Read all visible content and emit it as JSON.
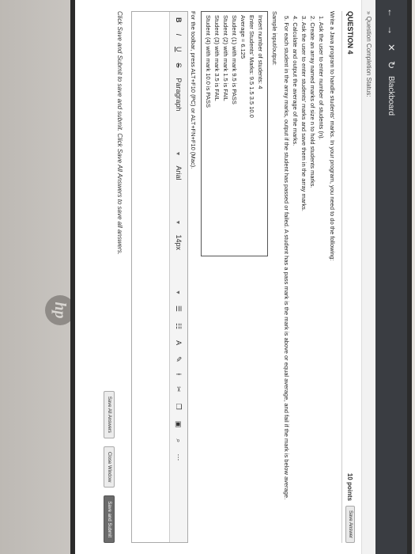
{
  "browser": {
    "tab_title": "Blackboard",
    "back_icon": "left-arrow-icon",
    "forward_icon": "right-arrow-icon"
  },
  "breadcrumb": "» Question Completion Status:",
  "question": {
    "title": "QUESTION 4",
    "points": "10 points",
    "save_answer": "Save Answer",
    "intro": "Write a Java program to handle students' marks. In your program, you need to do the following:",
    "steps": [
      "1. Ask the user to enter number of students (n).",
      "2. Create an array named marks of size n to hold students marks.",
      "3. Ask the user to enter students' marks and save them in the array marks.",
      "4. Calculate and output the average of the marks.",
      "5. For each student in the array marks, output if the student has passed or failed. A student has a pass mark is the mark is above or equal average, and fail if the mark is below average."
    ],
    "sample_label": "Sample input/output:",
    "sample_lines": [
      "Insert number of students: 4",
      "Enter Students' Marks: 9.5  1.5  3.5  10.0",
      "Average = 6.125",
      "Student (1) with mark 9.5 is PASS",
      "Student (2) with mark 1.5 is FAIL",
      "Student (3) with mark 3.5 is FAIL",
      "Student (4) with mark 10.0 is PASS"
    ]
  },
  "editor": {
    "toolbar_hint": "For the toolbar, press ALT+F10 (PC) or ALT+FN+F10 (Mac).",
    "bold": "B",
    "italic": "I",
    "underline": "U",
    "strike": "S",
    "paragraph": "Paragraph",
    "font": "Arial",
    "size": "14px"
  },
  "footer": {
    "note": "Click Save and Submit to save and submit. Click Save All Answers to save all answers.",
    "save_all": "Save All Answers",
    "close_window": "Close Window",
    "save_submit": "Save and Submit"
  }
}
